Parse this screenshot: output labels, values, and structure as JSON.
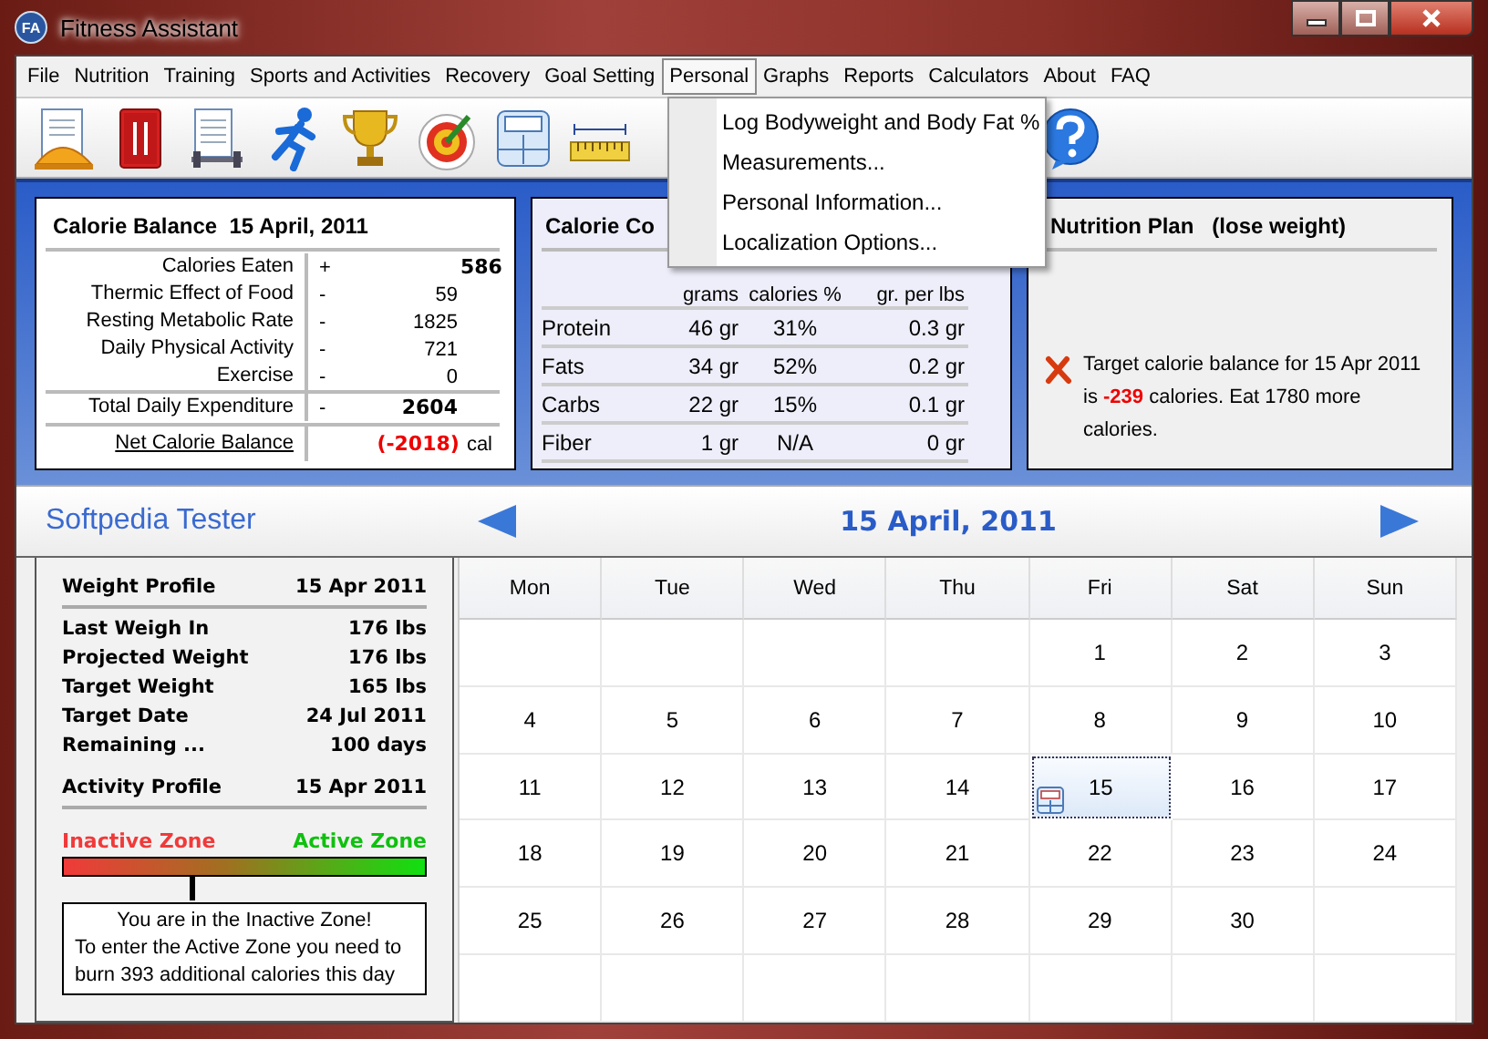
{
  "window": {
    "title": "Fitness Assistant",
    "badge": "FA"
  },
  "menu": [
    {
      "label": "File",
      "selected": false
    },
    {
      "label": "Nutrition",
      "selected": false
    },
    {
      "label": "Training",
      "selected": false
    },
    {
      "label": "Sports and Activities",
      "selected": false
    },
    {
      "label": "Recovery",
      "selected": false
    },
    {
      "label": "Goal Setting",
      "selected": false
    },
    {
      "label": "Personal",
      "selected": true
    },
    {
      "label": "Graphs",
      "selected": false
    },
    {
      "label": "Reports",
      "selected": false
    },
    {
      "label": "Calculators",
      "selected": false
    },
    {
      "label": "About",
      "selected": false
    },
    {
      "label": "FAQ",
      "selected": false
    }
  ],
  "toolbar": [
    {
      "kind": "meal"
    },
    {
      "kind": "book"
    },
    {
      "kind": "workout"
    },
    {
      "kind": "runner"
    },
    {
      "kind": "trophy"
    },
    {
      "kind": "target"
    },
    {
      "kind": "scale"
    },
    {
      "kind": "tape"
    },
    {
      "kind": "gap"
    },
    {
      "kind": "help"
    }
  ],
  "dropdown": [
    {
      "label": "Log Bodyweight and Body Fat %"
    },
    {
      "label": "Measurements..."
    },
    {
      "label": "Personal Information..."
    },
    {
      "label": "Localization Options..."
    }
  ],
  "calorie_balance": {
    "title": "Calorie Balance  15 April, 2011",
    "rows": [
      {
        "kind": "eaten",
        "label": "Calories Eaten",
        "sign": "+",
        "value": "586"
      },
      {
        "kind": "item",
        "label": "Thermic Effect of Food",
        "sign": "-",
        "value": "59"
      },
      {
        "kind": "item",
        "label": "Resting Metabolic Rate",
        "sign": "-",
        "value": "1825"
      },
      {
        "kind": "item",
        "label": "Daily Physical Activity",
        "sign": "-",
        "value": "721"
      },
      {
        "kind": "item",
        "label": "Exercise",
        "sign": "-",
        "value": "0"
      },
      {
        "kind": "total",
        "label": "Total Daily Expenditure",
        "sign": "-",
        "value": "2604"
      }
    ],
    "net": {
      "label": "Net Calorie Balance",
      "value": "(-2018)",
      "unit": "cal"
    }
  },
  "calorie_composition": {
    "title": "Calorie Co",
    "columns": [
      "grams",
      "calories %",
      "gr. per lbs"
    ],
    "rows": [
      {
        "name": "Protein",
        "cells": [
          "46 gr",
          "31%",
          "0.3 gr"
        ]
      },
      {
        "name": "Fats",
        "cells": [
          "34 gr",
          "52%",
          "0.2 gr"
        ]
      },
      {
        "name": "Carbs",
        "cells": [
          "22 gr",
          "15%",
          "0.1 gr"
        ]
      },
      {
        "name": "Fiber",
        "cells": [
          "1 gr",
          "N/A",
          "0 gr"
        ]
      }
    ]
  },
  "nutrition_plan": {
    "title": "Nutrition Plan   (lose weight)",
    "message": "Target calorie balance for 15 Apr 2011 is **-239** calories. Eat 1780 more calories."
  },
  "user_name": "Softpedia Tester",
  "date_header": "15 April, 2011",
  "profile": [
    {
      "kind": "heading",
      "label": "Weight Profile",
      "value": "15 Apr 2011"
    },
    {
      "kind": "item",
      "label": "Last Weigh In",
      "value": "176 lbs"
    },
    {
      "kind": "item",
      "label": "Projected Weight",
      "value": "176 lbs"
    },
    {
      "kind": "item",
      "label": "Target Weight",
      "value": "165 lbs"
    },
    {
      "kind": "item",
      "label": "Target Date",
      "value": "24 Jul 2011"
    },
    {
      "kind": "item",
      "label": "Remaining ...",
      "value": "100 days"
    },
    {
      "kind": "heading",
      "label": "Activity Profile",
      "value": "15 Apr 2011"
    }
  ],
  "zone": {
    "inactive_label": "Inactive Zone",
    "active_label": "Active Zone",
    "level": 0.35,
    "headline": "You are in the Inactive Zone!",
    "detail": "To enter the Active Zone you need to burn 393 additional calories this day"
  },
  "calendar": {
    "weekdays": [
      "Mon",
      "Tue",
      "Wed",
      "Thu",
      "Fri",
      "Sat",
      "Sun"
    ],
    "weeks": [
      [
        {
          "kind": "blank"
        },
        {
          "kind": "blank"
        },
        {
          "kind": "blank"
        },
        {
          "kind": "blank"
        },
        {
          "kind": "day",
          "day": "1",
          "selected": false
        },
        {
          "kind": "day",
          "day": "2",
          "selected": false
        },
        {
          "kind": "day",
          "day": "3",
          "selected": false
        }
      ],
      [
        {
          "kind": "day",
          "day": "4",
          "selected": false
        },
        {
          "kind": "day",
          "day": "5",
          "selected": false
        },
        {
          "kind": "day",
          "day": "6",
          "selected": false
        },
        {
          "kind": "day",
          "day": "7",
          "selected": false
        },
        {
          "kind": "day",
          "day": "8",
          "selected": false
        },
        {
          "kind": "day",
          "day": "9",
          "selected": false
        },
        {
          "kind": "day",
          "day": "10",
          "selected": false
        }
      ],
      [
        {
          "kind": "day",
          "day": "11",
          "selected": false
        },
        {
          "kind": "day",
          "day": "12",
          "selected": false
        },
        {
          "kind": "day",
          "day": "13",
          "selected": false
        },
        {
          "kind": "day",
          "day": "14",
          "selected": false
        },
        {
          "kind": "day",
          "day": "15",
          "selected": true,
          "has_entry": true
        },
        {
          "kind": "day",
          "day": "16",
          "selected": false
        },
        {
          "kind": "day",
          "day": "17",
          "selected": false
        }
      ],
      [
        {
          "kind": "day",
          "day": "18",
          "selected": false
        },
        {
          "kind": "day",
          "day": "19",
          "selected": false
        },
        {
          "kind": "day",
          "day": "20",
          "selected": false
        },
        {
          "kind": "day",
          "day": "21",
          "selected": false
        },
        {
          "kind": "day",
          "day": "22",
          "selected": false
        },
        {
          "kind": "day",
          "day": "23",
          "selected": false
        },
        {
          "kind": "day",
          "day": "24",
          "selected": false
        }
      ],
      [
        {
          "kind": "day",
          "day": "25",
          "selected": false
        },
        {
          "kind": "day",
          "day": "26",
          "selected": false
        },
        {
          "kind": "day",
          "day": "27",
          "selected": false
        },
        {
          "kind": "day",
          "day": "28",
          "selected": false
        },
        {
          "kind": "day",
          "day": "29",
          "selected": false
        },
        {
          "kind": "day",
          "day": "30",
          "selected": false
        },
        {
          "kind": "blank"
        }
      ],
      [
        {
          "kind": "blank"
        },
        {
          "kind": "blank"
        },
        {
          "kind": "blank"
        },
        {
          "kind": "blank"
        },
        {
          "kind": "blank"
        },
        {
          "kind": "blank"
        },
        {
          "kind": "blank"
        }
      ]
    ]
  }
}
